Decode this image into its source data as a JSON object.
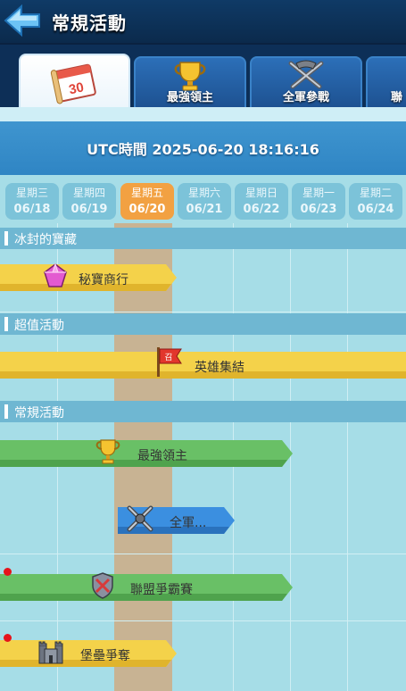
{
  "header": {
    "title": "常規活動",
    "back_icon": "back-arrow-icon"
  },
  "tabs": [
    {
      "label": "",
      "icon": "calendar-icon",
      "calendar_number": "30",
      "active": true
    },
    {
      "label": "最強領主",
      "icon": "trophy-icon"
    },
    {
      "label": "全軍參戰",
      "icon": "crossed-swords-icon"
    },
    {
      "label": "聯",
      "icon": ""
    }
  ],
  "utc": {
    "text": "UTC時間 2025-06-20 18:16:16"
  },
  "days": [
    {
      "weekday": "星期三",
      "date": "06/18"
    },
    {
      "weekday": "星期四",
      "date": "06/19"
    },
    {
      "weekday": "星期五",
      "date": "06/20",
      "active": true
    },
    {
      "weekday": "星期六",
      "date": "06/21"
    },
    {
      "weekday": "星期日",
      "date": "06/22"
    },
    {
      "weekday": "星期一",
      "date": "06/23"
    },
    {
      "weekday": "星期二",
      "date": "06/24"
    }
  ],
  "sections": [
    {
      "label": "冰封的寶藏"
    },
    {
      "label": "超值活動"
    },
    {
      "label": "常規活動"
    }
  ],
  "events": [
    {
      "label": "秘寶商行",
      "color": "yellow",
      "icon": "gem-icon"
    },
    {
      "label": "英雄集結",
      "color": "yellow",
      "icon": "flag-icon",
      "icon_text": "召"
    },
    {
      "label": "最強領主",
      "color": "green",
      "icon": "trophy-icon"
    },
    {
      "label": "全軍...",
      "color": "blue",
      "icon": "crossed-swords-icon"
    },
    {
      "label": "聯盟爭霸賽",
      "color": "green",
      "icon": "shield-icon",
      "red_dot": true
    },
    {
      "label": "堡壘爭奪",
      "color": "yellow",
      "icon": "fortress-icon",
      "red_dot": true
    }
  ],
  "colors": {
    "yellow": "#f4d24a",
    "green": "#69c066",
    "blue": "#3b8fe0",
    "active_day": "#f2a142",
    "header": "#0f3a66",
    "panel": "#a6dde7"
  }
}
